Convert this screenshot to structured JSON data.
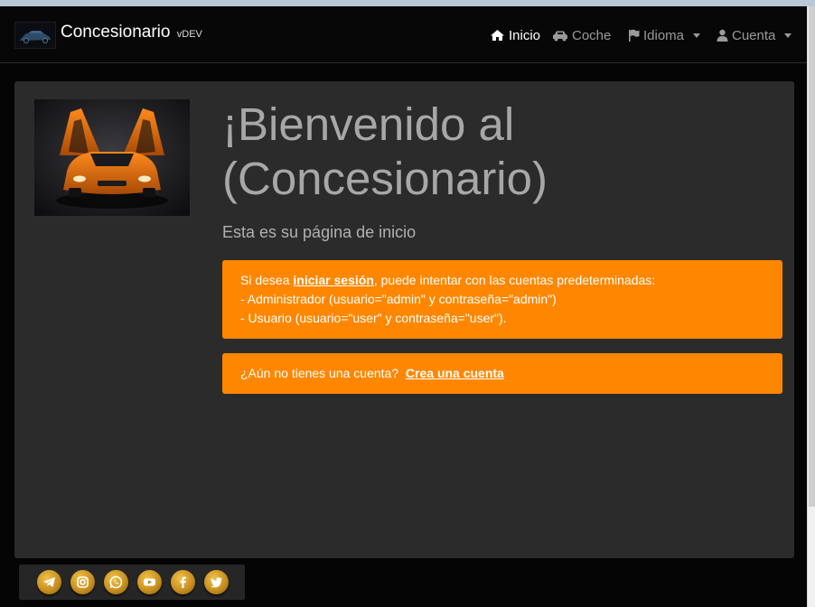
{
  "brand": {
    "name": "Concesionario",
    "version": "vDEV"
  },
  "nav": {
    "items": [
      {
        "label": "Inicio",
        "icon": "home-icon",
        "active": true
      },
      {
        "label": "Coche",
        "icon": "car-icon",
        "active": false
      },
      {
        "label": "Idioma",
        "icon": "flag-icon",
        "active": false,
        "dropdown": true
      },
      {
        "label": "Cuenta",
        "icon": "user-icon",
        "active": false,
        "dropdown": true
      }
    ]
  },
  "hero": {
    "title": "¡Bienvenido al (Concesionario)",
    "subtitle": "Esta es su página de inicio"
  },
  "alert_login": {
    "text_before": "Si desea ",
    "link_label": "iniciar sesión",
    "text_after": ", puede intentar con las cuentas predeterminadas:",
    "line_admin": "- Administrador (usuario=\"admin\" y contraseña=\"admin\")",
    "line_user": "- Usuario (usuario=\"user\" y contraseña=\"user\")."
  },
  "alert_register": {
    "text": "¿Aún no tienes una cuenta?",
    "link_label": "Crea una cuenta"
  },
  "social": [
    {
      "icon": "telegram-icon"
    },
    {
      "icon": "instagram-icon"
    },
    {
      "icon": "whatsapp-icon"
    },
    {
      "icon": "youtube-icon"
    },
    {
      "icon": "facebook-icon"
    },
    {
      "icon": "twitter-icon"
    }
  ],
  "colors": {
    "navbar": "#070707",
    "jumbotron": "#2b2b2b",
    "alert": "#ff8700",
    "social_gold": "#d4a02a",
    "title_text": "#a7a7a7"
  }
}
